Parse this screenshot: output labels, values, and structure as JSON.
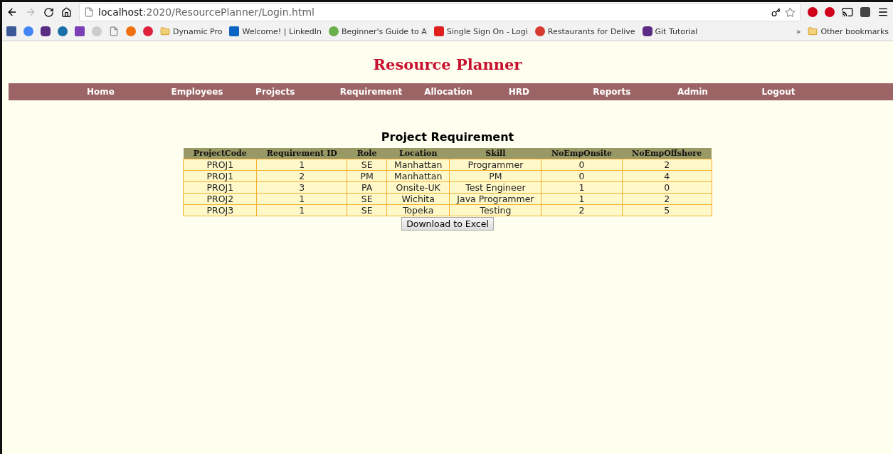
{
  "browser": {
    "address_host": "localhost",
    "address_path": ":2020/ResourcePlanner/Login.html",
    "bookmarks": [
      "Dynamic Pro",
      "Welcome! | LinkedIn",
      "Beginner's Guide to A",
      "Single Sign On - Logi",
      "Restaurants for Delive",
      "Git Tutorial"
    ],
    "overflow": "»",
    "other_bookmarks": "Other bookmarks"
  },
  "page": {
    "title": "Resource Planner",
    "nav": [
      "Home",
      "Employees",
      "Projects",
      "Requirement",
      "Allocation",
      "HRD",
      "Reports",
      "Admin",
      "Logout"
    ],
    "heading": "Project Requirement",
    "table": {
      "columns": [
        "ProjectCode",
        "Requirement ID",
        "Role",
        "Location",
        "Skill",
        "NoEmpOnsite",
        "NoEmpOffshore"
      ],
      "rows": [
        [
          "PROJ1",
          "1",
          "SE",
          "Manhattan",
          "Programmer",
          "0",
          "2"
        ],
        [
          "PROJ1",
          "2",
          "PM",
          "Manhattan",
          "PM",
          "0",
          "4"
        ],
        [
          "PROJ1",
          "3",
          "PA",
          "Onsite-UK",
          "Test Engineer",
          "1",
          "0"
        ],
        [
          "PROJ2",
          "1",
          "SE",
          "Wichita",
          "Java Programmer",
          "1",
          "2"
        ],
        [
          "PROJ3",
          "1",
          "SE",
          "Topeka",
          "Testing",
          "2",
          "5"
        ]
      ]
    },
    "download_button": "Download to Excel"
  }
}
